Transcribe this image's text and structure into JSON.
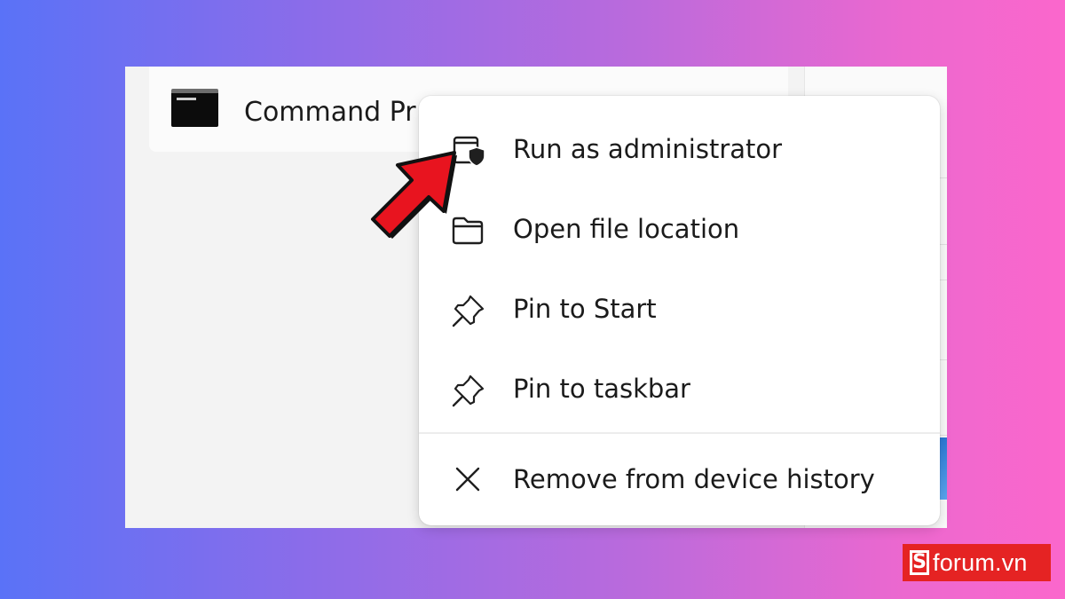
{
  "app_row": {
    "name": "Command Pr"
  },
  "context_menu": {
    "items": [
      {
        "label": "Run as administrator",
        "icon": "shield-window-icon"
      },
      {
        "label": "Open file location",
        "icon": "folder-icon"
      },
      {
        "label": "Pin to Start",
        "icon": "pin-icon"
      },
      {
        "label": "Pin to taskbar",
        "icon": "pin-icon"
      },
      {
        "label": "Remove from device history",
        "icon": "close-icon"
      }
    ]
  },
  "annotation": {
    "arrow_color": "#e8141f"
  },
  "watermark": {
    "mark": "S",
    "brand": "forum.vn",
    "color": "#e52323"
  }
}
